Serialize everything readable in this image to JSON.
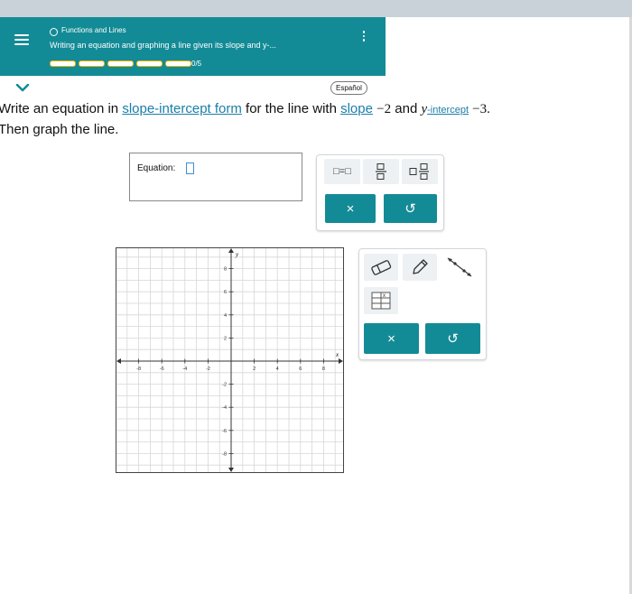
{
  "header": {
    "topic": "Functions and Lines",
    "subtitle": "Writing an equation and graphing a line given its slope and y-...",
    "progress_text": "0/5",
    "progress_segments": 5,
    "progress_completed": 0
  },
  "language_button": "Español",
  "prompt": {
    "p1": "Write an equation in ",
    "link1": "slope-intercept form",
    "p2": " for the line with ",
    "link2": "slope",
    "slope_value": "−2",
    "p3": " and ",
    "y_var": "y",
    "link3": "-intercept",
    "intercept_value": "−3.",
    "line2": "Then graph the line."
  },
  "equation": {
    "label": "Equation:"
  },
  "palette": {
    "tool_equals": "□=□",
    "clear": "×",
    "undo": "↺"
  },
  "graph_tools": {
    "clear": "×",
    "undo": "↺"
  },
  "graph": {
    "x_label": "x",
    "y_label": "y",
    "x_ticks": [
      "-8",
      "-6",
      "-4",
      "-2",
      "2",
      "4",
      "6",
      "8"
    ],
    "y_ticks": [
      "8",
      "6",
      "4",
      "2",
      "-2",
      "-4",
      "-6",
      "-8"
    ]
  },
  "colors": {
    "header_teal": "#138b96",
    "progress_gold": "#f0b400",
    "link_blue": "#1a7ea8"
  }
}
